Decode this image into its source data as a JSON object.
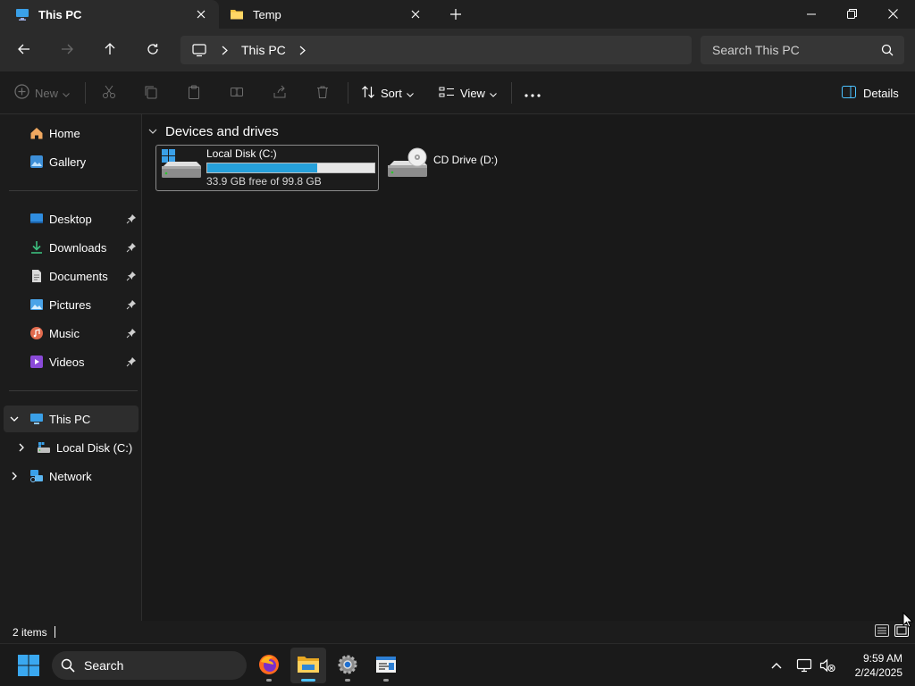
{
  "window": {
    "tabs": [
      {
        "label": "This PC",
        "icon": "monitor-icon",
        "active": true
      },
      {
        "label": "Temp",
        "icon": "folder-icon",
        "active": false
      }
    ],
    "controls": {
      "minimize": "minimize-icon",
      "restore": "restore-icon",
      "close": "close-icon"
    }
  },
  "address_bar": {
    "breadcrumb": [
      "This PC"
    ],
    "search_placeholder": "Search This PC"
  },
  "toolbar": {
    "new_label": "New",
    "sort_label": "Sort",
    "view_label": "View",
    "details_label": "Details"
  },
  "sidebar": {
    "top": [
      {
        "label": "Home",
        "icon": "home-icon"
      },
      {
        "label": "Gallery",
        "icon": "gallery-icon"
      }
    ],
    "quick_access": [
      {
        "label": "Desktop",
        "icon": "desktop-icon",
        "pinned": true
      },
      {
        "label": "Downloads",
        "icon": "downloads-icon",
        "pinned": true
      },
      {
        "label": "Documents",
        "icon": "documents-icon",
        "pinned": true
      },
      {
        "label": "Pictures",
        "icon": "pictures-icon",
        "pinned": true
      },
      {
        "label": "Music",
        "icon": "music-icon",
        "pinned": true
      },
      {
        "label": "Videos",
        "icon": "videos-icon",
        "pinned": true
      }
    ],
    "tree": [
      {
        "label": "This PC",
        "icon": "pc-icon",
        "expanded": true,
        "selected": true
      },
      {
        "label": "Local Disk (C:)",
        "icon": "drive-icon",
        "expanded": false
      },
      {
        "label": "Network",
        "icon": "network-icon",
        "expanded": false
      }
    ]
  },
  "content": {
    "group_title": "Devices and drives",
    "drives": [
      {
        "name": "Local Disk (C:)",
        "free_text": "33.9 GB free of 99.8 GB",
        "used_fraction": 0.66
      },
      {
        "name": "CD Drive (D:)"
      }
    ]
  },
  "status": {
    "item_count": "2 items"
  },
  "taskbar": {
    "search_label": "Search",
    "time": "9:59 AM",
    "date": "2/24/2025",
    "apps": [
      "firefox-icon",
      "file-explorer-icon",
      "settings-icon",
      "notepad-icon"
    ]
  },
  "colors": {
    "accent": "#4cc2ff",
    "progress": "#26a0da",
    "background": "#191919"
  }
}
